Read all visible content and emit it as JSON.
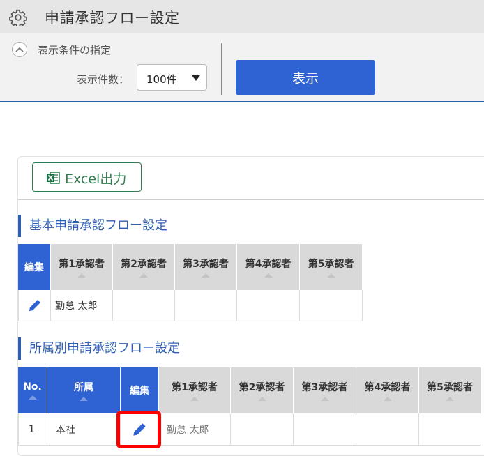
{
  "app": {
    "title": "申請承認フロー設定"
  },
  "conditions": {
    "toggle_label": "表示条件の指定",
    "count_label": "表示件数：",
    "count_value": "100件",
    "show_button": "表示"
  },
  "toolbar": {
    "excel_label": "Excel出力"
  },
  "basic": {
    "title": "基本申請承認フロー設定",
    "headers": [
      "編集",
      "第1承認者",
      "第2承認者",
      "第3承認者",
      "第4承認者",
      "第5承認者"
    ],
    "row": [
      "",
      "勤怠 太郎",
      "",
      "",
      "",
      ""
    ]
  },
  "dept": {
    "title": "所属別申請承認フロー設定",
    "headers": [
      "No.",
      "所属",
      "編集",
      "第1承認者",
      "第2承認者",
      "第3承認者",
      "第4承認者",
      "第5承認者"
    ],
    "row": [
      "1",
      "本社",
      "",
      "勤怠 太郎",
      "",
      "",
      "",
      ""
    ]
  },
  "colors": {
    "accent": "#2f62d2",
    "excel_green": "#2e7d4f",
    "highlight": "#ff0000"
  }
}
